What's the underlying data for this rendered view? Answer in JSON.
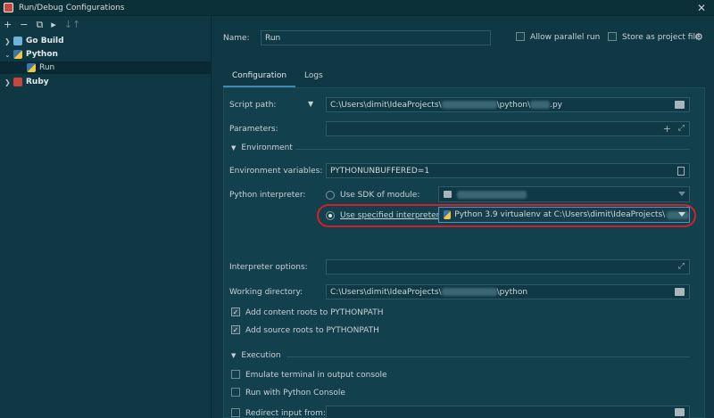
{
  "window": {
    "title": "Run/Debug Configurations"
  },
  "toolbar": {
    "add": "+",
    "remove": "−",
    "copy": "⧉",
    "folder": "▸",
    "sort": "↓↑"
  },
  "tree": [
    {
      "label": "Go Build"
    },
    {
      "label": "Python"
    },
    {
      "label": "Run"
    },
    {
      "label": "Ruby"
    }
  ],
  "header": {
    "name_label": "Name:",
    "name_value": "Run",
    "allow_parallel": "Allow parallel run",
    "store_as_file": "Store as project file"
  },
  "tabs": [
    "Configuration",
    "Logs"
  ],
  "config": {
    "script_label": "Script path:",
    "script_prefix": "C:\\Users\\dimit\\IdeaProjects\\",
    "script_mid": "\\python\\",
    "script_suffix": ".py",
    "parameters_label": "Parameters:",
    "environment_header": "Environment",
    "env_vars_label": "Environment variables:",
    "env_vars_value": "PYTHONUNBUFFERED=1",
    "interpreter_label": "Python interpreter:",
    "use_sdk_label": "Use SDK of module:",
    "use_specified_label": "Use specified interpreter:",
    "interpreter_value": "Python 3.9 virtualenv at C:\\Users\\dimit\\IdeaProjects\\",
    "interpreter_options_label": "Interpreter options:",
    "working_dir_label": "Working directory:",
    "working_dir_prefix": "C:\\Users\\dimit\\IdeaProjects\\",
    "working_dir_suffix": "\\python",
    "add_content_roots": "Add content roots to PYTHONPATH",
    "add_source_roots": "Add source roots to PYTHONPATH",
    "execution_header": "Execution",
    "emulate_terminal": "Emulate terminal in output console",
    "run_with_console": "Run with Python Console",
    "redirect_input": "Redirect input from:"
  },
  "colors": {
    "background": "#0f3844",
    "highlight": "#d2202a",
    "tab_underline": "#3f8ab5"
  }
}
